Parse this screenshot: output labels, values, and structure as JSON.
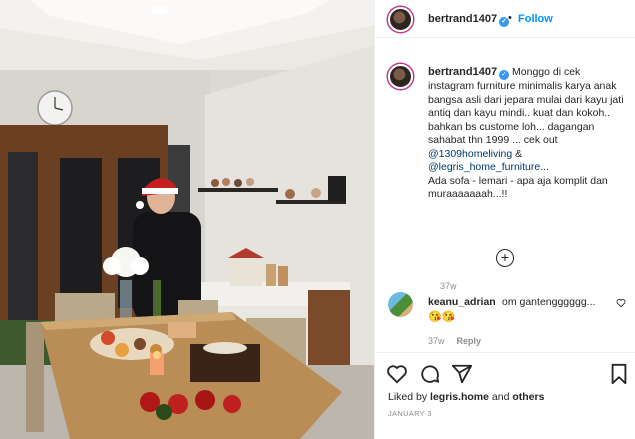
{
  "post": {
    "username": "bertrand1407",
    "verified_mark": "✓",
    "dot": "•",
    "follow_label": "Follow",
    "caption_username": "bertrand1407",
    "caption_part1": "Monggo di cek instagram furniture minimalis karya anak bangsa asli dari jepara mulai dari kayu jati antiq dan kayu mindi.. kuat dan kokoh.. bahkan bs custome loh... dagangan sahabat thn 1999 ... cek out ",
    "mention1": "@1309homeliving",
    "caption_part2": " & ",
    "mention2": "@legris_home_furniture",
    "caption_part3": "...\nAda sofa - lemari - apa aja komplit dan muraaaaaaah...!!",
    "caption_time": "37w",
    "load_more_icon": "plus-circle-icon"
  },
  "comment": {
    "username": "keanu_adrian",
    "text": "om gantengggggg...",
    "emojis": "😘😘",
    "time": "37w",
    "reply_label": "Reply"
  },
  "actions": {
    "icons": [
      "heart-icon",
      "comment-icon",
      "share-icon",
      "bookmark-icon"
    ],
    "liked_by_prefix": "Liked by ",
    "liked_by_user": "legris.home",
    "liked_by_and": " and ",
    "liked_by_others": "others",
    "date": "JANUARY 3"
  },
  "colors": {
    "link": "#00376b",
    "follow": "#0095f6",
    "meta": "#8e8e8e",
    "wall": "#dcd8d2",
    "table": "#b98d55"
  }
}
